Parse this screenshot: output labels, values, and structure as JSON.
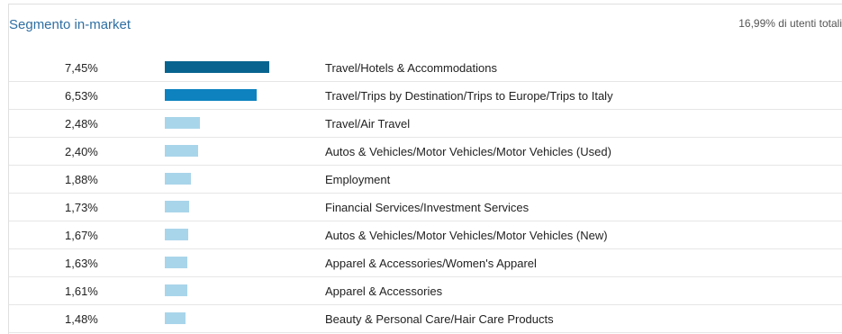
{
  "header": {
    "title": "Segmento in-market",
    "total": "16,99% di utenti totali"
  },
  "rows": [
    {
      "pct": "7,45%",
      "value": 7.45,
      "label": "Travel/Hotels & Accommodations",
      "color": "#08648f"
    },
    {
      "pct": "6,53%",
      "value": 6.53,
      "label": "Travel/Trips by Destination/Trips to Europe/Trips to Italy",
      "color": "#0d82bf"
    },
    {
      "pct": "2,48%",
      "value": 2.48,
      "label": "Travel/Air Travel",
      "color": "#a9d5ea"
    },
    {
      "pct": "2,40%",
      "value": 2.4,
      "label": "Autos & Vehicles/Motor Vehicles/Motor Vehicles (Used)",
      "color": "#a9d5ea"
    },
    {
      "pct": "1,88%",
      "value": 1.88,
      "label": "Employment",
      "color": "#a9d5ea"
    },
    {
      "pct": "1,73%",
      "value": 1.73,
      "label": "Financial Services/Investment Services",
      "color": "#a9d5ea"
    },
    {
      "pct": "1,67%",
      "value": 1.67,
      "label": "Autos & Vehicles/Motor Vehicles/Motor Vehicles (New)",
      "color": "#a9d5ea"
    },
    {
      "pct": "1,63%",
      "value": 1.63,
      "label": "Apparel & Accessories/Women's Apparel",
      "color": "#a9d5ea"
    },
    {
      "pct": "1,61%",
      "value": 1.61,
      "label": "Apparel & Accessories",
      "color": "#a9d5ea"
    },
    {
      "pct": "1,48%",
      "value": 1.48,
      "label": "Beauty & Personal Care/Hair Care Products",
      "color": "#a9d5ea"
    }
  ]
}
